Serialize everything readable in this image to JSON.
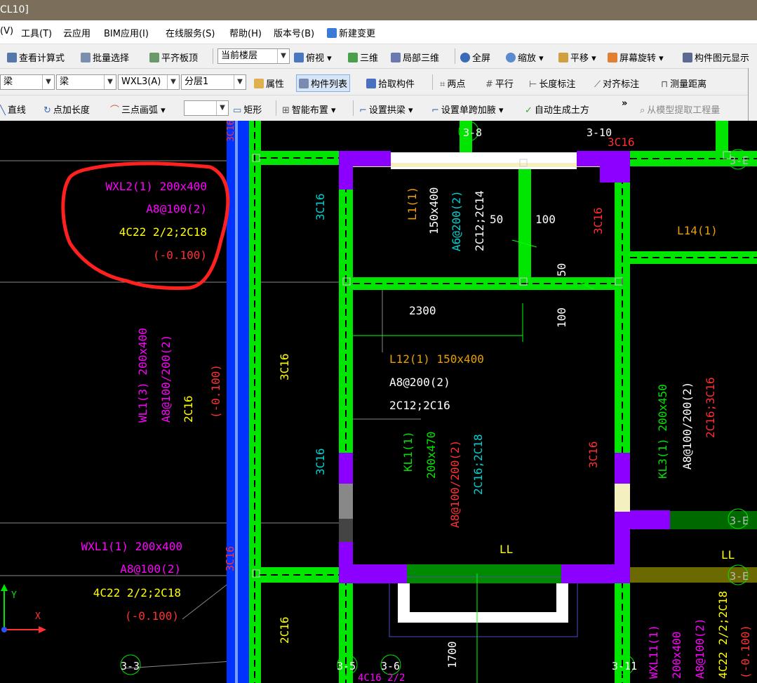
{
  "window": {
    "title": "CL10]"
  },
  "menu": [
    "(V)",
    "工具(T)",
    "云应用",
    "BIM应用(I)",
    "在线服务(S)",
    "帮助(H)",
    "版本号(B)",
    "新建变更"
  ],
  "toolbar1": {
    "view_formula": "查看计算式",
    "batch_select": "批量选择",
    "flush_slab_top": "平齐板顶",
    "floor_combo": "当前楼层",
    "top_view": "俯视",
    "three_d": "三维",
    "local_3d": "局部三维",
    "fullscreen": "全屏",
    "zoom": "缩放",
    "pan": "平移",
    "screen_rotate": "屏幕旋转",
    "component_display": "构件图元显示"
  },
  "toolbar2": {
    "combo1": "梁",
    "combo2": "梁",
    "combo3": "WXL3(A)",
    "combo4": "分层1",
    "properties": "属性",
    "component_list": "构件列表",
    "pick_component": "拾取构件",
    "two_points": "两点",
    "parallel": "平行",
    "length_dim": "长度标注",
    "align_dim": "对齐标注",
    "measure_distance": "测量距离"
  },
  "toolbar3": {
    "line": "直线",
    "point_length": "点加长度",
    "three_point_arc": "三点画弧",
    "rectangle": "矩形",
    "smart_layout": "智能布置",
    "set_arch_beam": "设置拱梁",
    "set_haunch": "设置单跨加腋",
    "auto_earthwork": "自动生成土方",
    "more": "»",
    "extract_from_model": "从模型提取工程量"
  },
  "colors": {
    "beam_green": "#00e600",
    "column_purple": "#8c00ff",
    "wall_blue": "#0033ff",
    "text_magenta": "#ff00ff",
    "text_yellow": "#ffff00",
    "text_red": "#ff3030",
    "text_cyan": "#00d0d0",
    "text_white": "#ffffff",
    "text_orange": "#e8a000",
    "highlight_red": "#ff2020"
  },
  "annotations": {
    "wxl2": {
      "name": "WXL2(1) 200x400",
      "stirrup": "A8@100(2)",
      "rebar": "4C22 2/2;2C18",
      "elev": "(-0.100)"
    },
    "wxl1": {
      "name": "WXL1(1) 200x400",
      "stirrup": "A8@100(2)",
      "rebar": "4C22 2/2;2C18",
      "elev": "(-0.100)"
    },
    "wl1": {
      "name": "WL1(3) 200x400",
      "stirrup": "A8@100/200(2)",
      "rebar": "2C16",
      "elev": "(-0.100)"
    },
    "l1": {
      "name": "L1(1)",
      "size": "150x400",
      "stirrup": "A6@200(2)",
      "rebar": "2C12;2C14"
    },
    "l12": {
      "name": "L12(1) 150x400",
      "stirrup": "A8@200(2)",
      "rebar": "2C12;2C16"
    },
    "kl1": {
      "name": "KL1(1)",
      "size": "200x470",
      "stirrup": "A8@100/200(2)",
      "rebar": "2C16;2C18"
    },
    "kl3": {
      "name": "KL3(1) 200x450",
      "stirrup": "A8@100/200(2)",
      "rebar": "2C16;3C16"
    },
    "wxl11": {
      "name": "WXL11(1)",
      "size": "200x400",
      "stirrup": "A8@100(2)",
      "rebar": "4C22 2/2;2C18",
      "elev": "(-0.100)"
    },
    "l14": "L14(1)",
    "ll1": "LL",
    "ll2": "LL",
    "dims": {
      "d50a": "50",
      "d100a": "100",
      "d50b": "50",
      "d100b": "100",
      "d2300": "2300",
      "d1700": "1700"
    },
    "rebar_3c16": "3C16",
    "rebar_2c16": "2C16",
    "rebar_3c16_red": "3C16",
    "section_3_8": "3-8",
    "section_3_10": "3-10",
    "section_3_3": "3-3",
    "section_3_5": "3-5",
    "section_3_6": "3-6",
    "section_3_11": "3-11",
    "section_3_e": "3-E",
    "section_3c16_top": "3C16",
    "axis_y": "Y",
    "axis_x": "X",
    "bottom_text": "4C16 2/2"
  }
}
